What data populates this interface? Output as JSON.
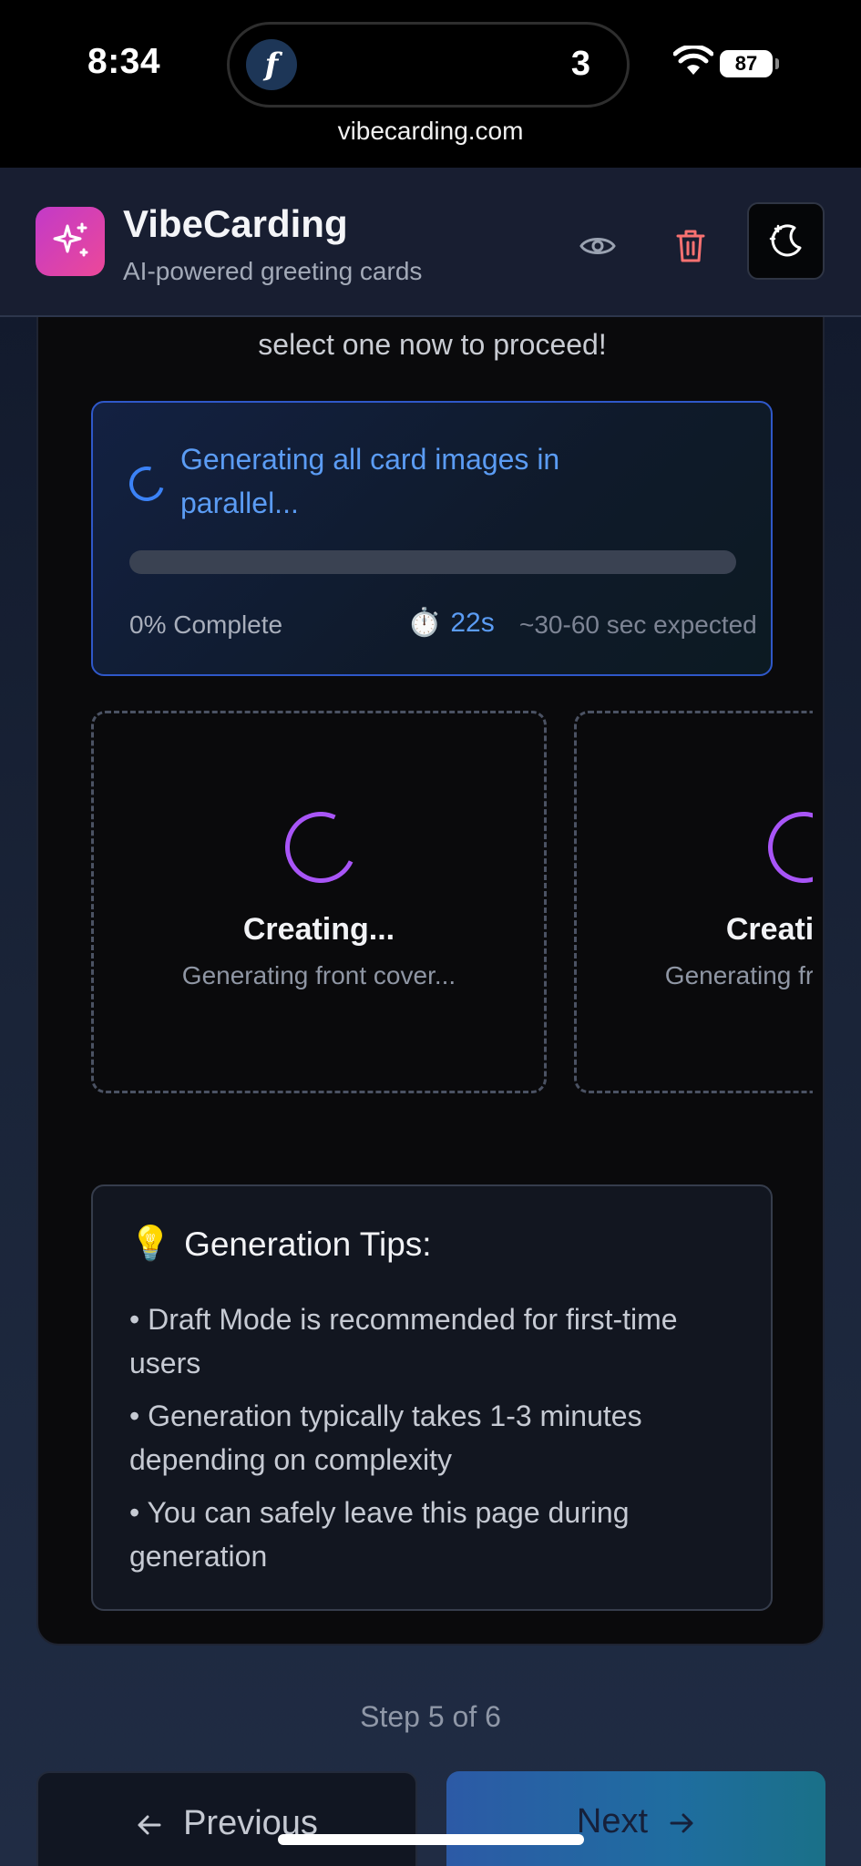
{
  "status_bar": {
    "time": "8:34",
    "island_badge": "3",
    "island_app_glyph": "f",
    "battery": "87",
    "url": "vibecarding.com"
  },
  "header": {
    "title": "VibeCarding",
    "subtitle": "AI-powered greeting cards",
    "logo_icon": "sparkles-icon",
    "accent_gradient": [
      "#c23ac8",
      "#ec4899"
    ],
    "trash_color": "#f87171"
  },
  "main": {
    "instruction": "select one now to proceed!",
    "progress": {
      "message": "Generating all card images in parallel...",
      "percent": 0,
      "percent_label": "0% Complete",
      "timer_icon": "⏱️",
      "elapsed": "22s",
      "expected": "~30-60 sec expected",
      "accent": "#3b82f6"
    },
    "cards": [
      {
        "title": "Creating...",
        "subtitle": "Generating front cover..."
      },
      {
        "title": "Creating...",
        "subtitle": "Generating front cover..."
      }
    ],
    "tips": {
      "icon": "💡",
      "title": "Generation Tips:",
      "items": [
        "• Draft Mode is recommended for first-time users",
        "• Generation typically takes 1-3 minutes depending on complexity",
        "• You can safely leave this page during generation"
      ]
    }
  },
  "footer": {
    "step": "Step 5 of 6",
    "previous_label": "Previous",
    "next_label": "Next"
  }
}
